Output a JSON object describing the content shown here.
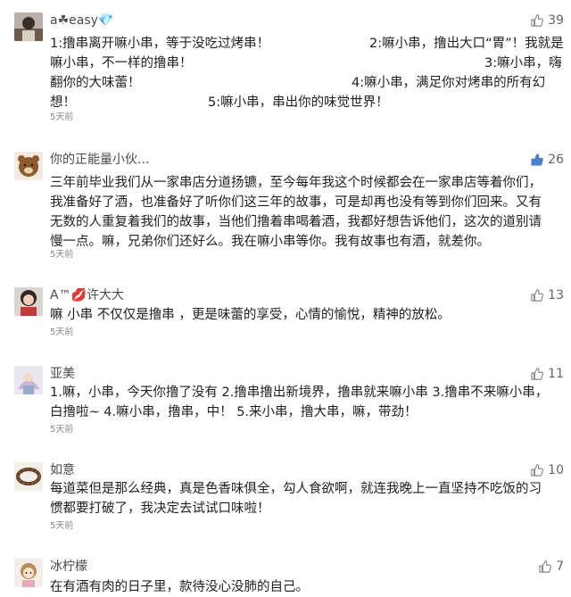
{
  "icons": {
    "thumb_icon": "thumbs-up-icon",
    "thumb_color_default": "#8a8a8a",
    "thumb_color_liked": "#4e7fcf"
  },
  "comments": [
    {
      "user": "a☘easy💎",
      "likes": "39",
      "liked": false,
      "lines": [
        [
          "1:撸串离开嘛小串，等于没吃过烤串！",
          "2:嘛小串，撸出大口“胃”！我就是"
        ],
        [
          "嘛小串，不一样的撸串！",
          "3:嘛小串，嗨"
        ],
        [
          "翻你的大味蕾！",
          "4:嘛小串，满足你对烤串的所有幻"
        ],
        [
          "想！",
          "5:嘛小串，串出你的味觉世界！"
        ]
      ],
      "time": "5天前"
    },
    {
      "user": "你的正能量小伙...",
      "likes": "26",
      "liked": true,
      "text_lines": [
        "三年前毕业我们从一家串店分道扬镳，至今每年我这个时候都会在一家串店等着你们，",
        "我准备好了酒，也准备好了听你们这三年的故事，可是却再也没有等到你们回来。又有",
        "无数的人重复着我们的故事，当他们撸着串喝着酒，我都好想告诉他们，这次的道别请",
        "慢一点。嘛，兄弟你们还好么。我在嘛小串等你。我有故事也有酒，就差你。"
      ],
      "time": "5天前"
    },
    {
      "user": "A™💋许大大",
      "likes": "13",
      "liked": false,
      "text_lines": [
        "嘛 小串  不仅仅是撸串 ，更是味蕾的享受，心情的愉悅，精神的放松。"
      ],
      "time": "5天前"
    },
    {
      "user": "亚美",
      "likes": "11",
      "liked": false,
      "text_lines": [
        "1.嘛，小串，今天你撸了没有 2.撸串撸出新境界，撸串就来嘛小串 3.撸串不来嘛小串，",
        "白撸啦~ 4.嘛小串，撸串，中！ 5.来小串，撸大串，嘛，带劲！"
      ],
      "time": "5天前"
    },
    {
      "user": "如意",
      "likes": "10",
      "liked": false,
      "text_lines": [
        "每道菜但是那么经典，真是色香味俱全，勾人食欲啊，就连我晚上一直坚持不吃饭的习",
        "惯都要打破了，我决定去试试口味啦！"
      ],
      "time": "5天前"
    },
    {
      "user": "冰柠檬",
      "likes": "7",
      "liked": false,
      "text_lines": [
        "在有酒有肉的日子里，款待没心没肺的自己。"
      ]
    }
  ]
}
